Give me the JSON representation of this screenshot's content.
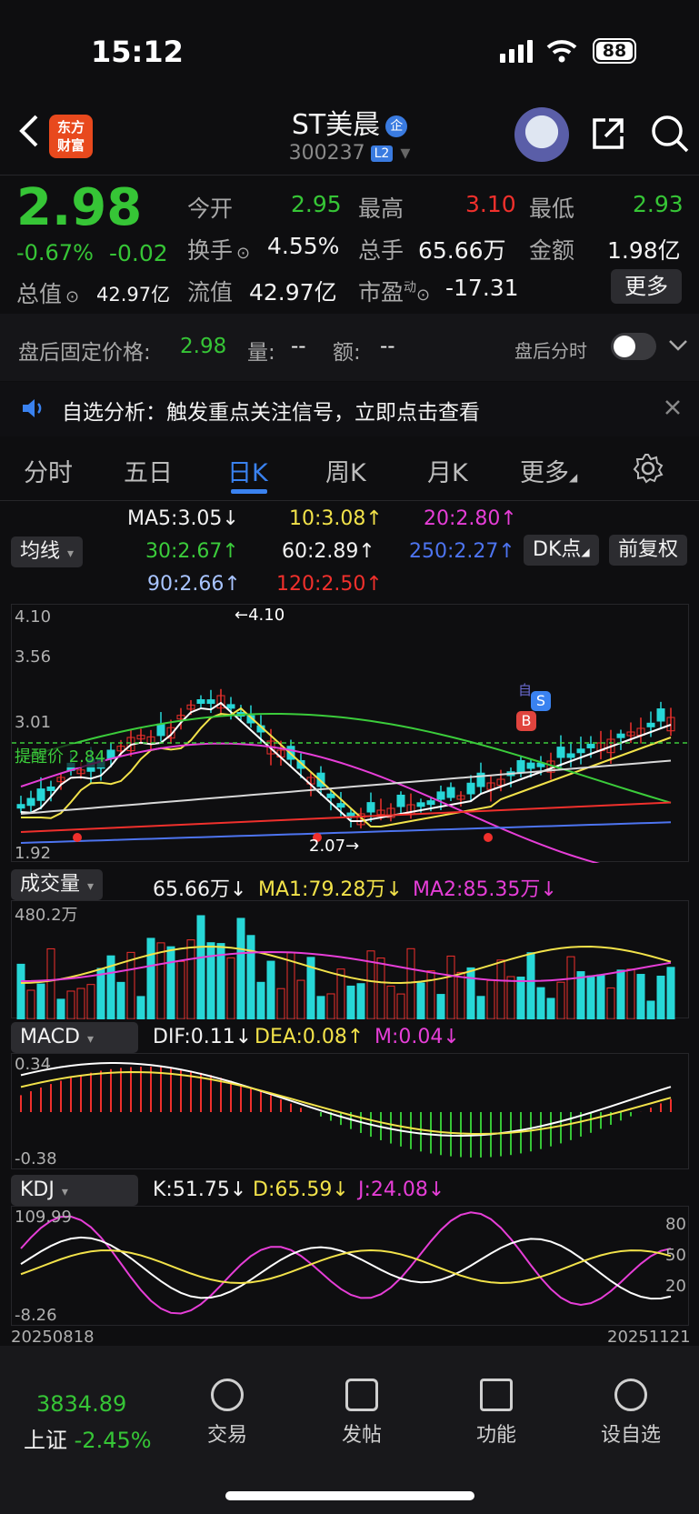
{
  "status": {
    "time": "15:12",
    "battery": "88"
  },
  "header": {
    "logo": "东方\n财富",
    "title": "ST美晨",
    "qi": "企",
    "code": "300237",
    "level": "L2"
  },
  "quote": {
    "price": "2.98",
    "change_pct": "-0.67%",
    "change": "-0.02",
    "total_value_label": "总值",
    "total_value": "42.97亿",
    "open_label": "今开",
    "open": "2.95",
    "high_label": "最高",
    "high": "3.10",
    "low_label": "最低",
    "low": "2.93",
    "turnover_label": "换手",
    "turnover": "4.55%",
    "volume_label": "总手",
    "volume": "65.66万",
    "amount_label": "金额",
    "amount": "1.98亿",
    "float_label": "流值",
    "float_value": "42.97亿",
    "pe_label": "市盈",
    "pe_sup": "动",
    "pe": "-17.31",
    "more": "更多"
  },
  "after_hours": {
    "label": "盘后固定价格:",
    "price": "2.98",
    "vol_label": "量:",
    "vol": "--",
    "amt_label": "额:",
    "amt": "--",
    "tick_label": "盘后分时"
  },
  "notice": {
    "text": "自选分析：触发重点关注信号，立即点击查看"
  },
  "tabs": [
    "分时",
    "五日",
    "日K",
    "周K",
    "月K",
    "更多"
  ],
  "ma": {
    "select": "均线",
    "ma5": "MA5:3.05",
    "ma5_arrow": "↓",
    "ma10": "10:3.08",
    "ma10_arrow": "↑",
    "ma20": "20:2.80",
    "ma20_arrow": "↑",
    "ma30": "30:2.67",
    "ma30_arrow": "↑",
    "ma60": "60:2.89",
    "ma60_arrow": "↑",
    "ma250": "250:2.27",
    "ma250_arrow": "↑",
    "ma90": "90:2.66",
    "ma90_arrow": "↑",
    "ma120": "120:2.50",
    "ma120_arrow": "↑",
    "dk": "DK点",
    "fq": "前复权"
  },
  "kline": {
    "y_labels": [
      "4.10",
      "3.56",
      "3.01",
      "1.92"
    ],
    "reminder": "提醒价 2.84",
    "high_mark": "←4.10",
    "low_mark": "2.07→",
    "tag_b": "B",
    "tag_s": "S",
    "tag_zi": "自"
  },
  "volume": {
    "select": "成交量",
    "vol": "65.66万",
    "vol_arrow": "↓",
    "ma1": "MA1:79.28万",
    "ma1_arrow": "↓",
    "ma2": "MA2:85.35万",
    "ma2_arrow": "↓",
    "y_label": "480.2万"
  },
  "macd": {
    "select": "MACD",
    "dif": "DIF:0.11",
    "dif_arrow": "↓",
    "dea": "DEA:0.08",
    "dea_arrow": "↑",
    "m": "M:0.04",
    "m_arrow": "↓",
    "y_top": "0.34",
    "y_bottom": "-0.38"
  },
  "kdj": {
    "select": "KDJ",
    "k": "K:51.75",
    "k_arrow": "↓",
    "d": "D:65.59",
    "d_arrow": "↓",
    "j": "J:24.08",
    "j_arrow": "↓",
    "y_top": "109.99",
    "y_bottom": "-8.26",
    "r80": "80",
    "r50": "50",
    "r20": "20"
  },
  "dates": {
    "start": "20250818",
    "end": "20251121"
  },
  "bottom": {
    "index_value": "3834.89",
    "index_name": "上证",
    "index_change": "-2.45%",
    "items": [
      "交易",
      "发帖",
      "功能",
      "设自选"
    ]
  }
}
